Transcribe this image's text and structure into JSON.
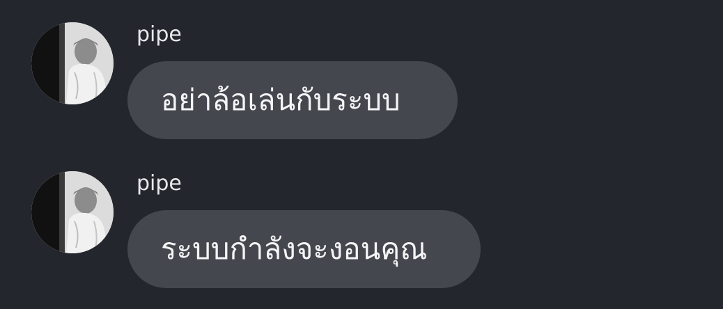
{
  "messages": [
    {
      "sender": "pipe",
      "text": "อย่าล้อเล่นกับระบบ",
      "avatar_icon": "user-avatar-photo"
    },
    {
      "sender": "pipe",
      "text": "ระบบกำลังจะงอนคุณ",
      "avatar_icon": "user-avatar-photo"
    }
  ],
  "colors": {
    "background": "#24262e",
    "bubble": "#45474e",
    "text": "#f4f4f6",
    "sender": "#e9e9ec"
  }
}
